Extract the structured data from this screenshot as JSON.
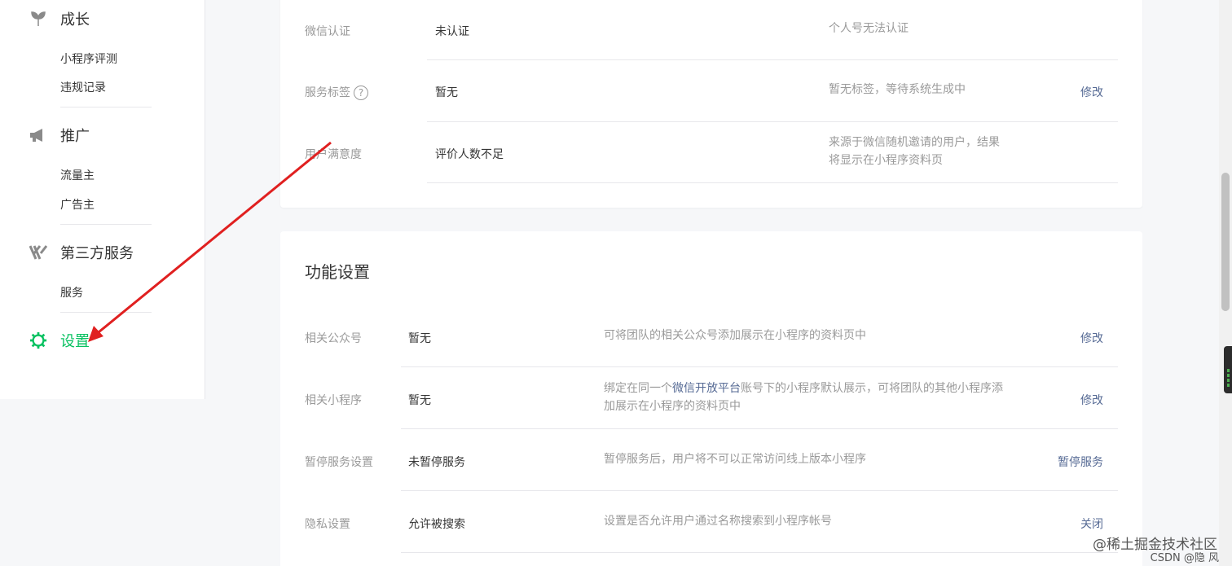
{
  "sidebar": {
    "growth": {
      "label": "成长",
      "items": [
        "小程序评测",
        "违规记录"
      ]
    },
    "promotion": {
      "label": "推广",
      "items": [
        "流量主",
        "广告主"
      ]
    },
    "third_party": {
      "label": "第三方服务",
      "items": [
        "服务"
      ]
    },
    "settings": {
      "label": "设置"
    }
  },
  "basic_info": {
    "rows": [
      {
        "label": "微信认证",
        "value": "未认证",
        "desc": "个人号无法认证",
        "action": ""
      },
      {
        "label": "服务标签",
        "help": "?",
        "value": "暂无",
        "desc": "暂无标签，等待系统生成中",
        "action": "修改"
      },
      {
        "label": "用户满意度",
        "value": "评价人数不足",
        "desc_line1": "来源于微信随机邀请的用户，结果",
        "desc_line2": "将显示在小程序资料页",
        "action": ""
      }
    ]
  },
  "function_settings": {
    "title": "功能设置",
    "rows": [
      {
        "label": "相关公众号",
        "value": "暂无",
        "desc": "可将团队的相关公众号添加展示在小程序的资料页中",
        "action": "修改"
      },
      {
        "label": "相关小程序",
        "value": "暂无",
        "desc_pre": "绑定在同一个",
        "desc_link": "微信开放平台",
        "desc_post": "账号下的小程序默认展示，可将团队的其他小程序添",
        "desc_line2": "加展示在小程序的资料页中",
        "action": "修改"
      },
      {
        "label": "暂停服务设置",
        "value": "未暂停服务",
        "desc": "暂停服务后，用户将不可以正常访问线上版本小程序",
        "action": "暂停服务"
      },
      {
        "label": "隐私设置",
        "value": "允许被搜索",
        "desc": "设置是否允许用户通过名称搜索到小程序帐号",
        "action": "关闭"
      }
    ]
  },
  "watermark": {
    "line1": "@稀土掘金技术社区",
    "line2": "CSDN @隐 风"
  },
  "colors": {
    "accent": "#07c160",
    "link": "#576b95",
    "annotation_arrow": "#e02020"
  }
}
